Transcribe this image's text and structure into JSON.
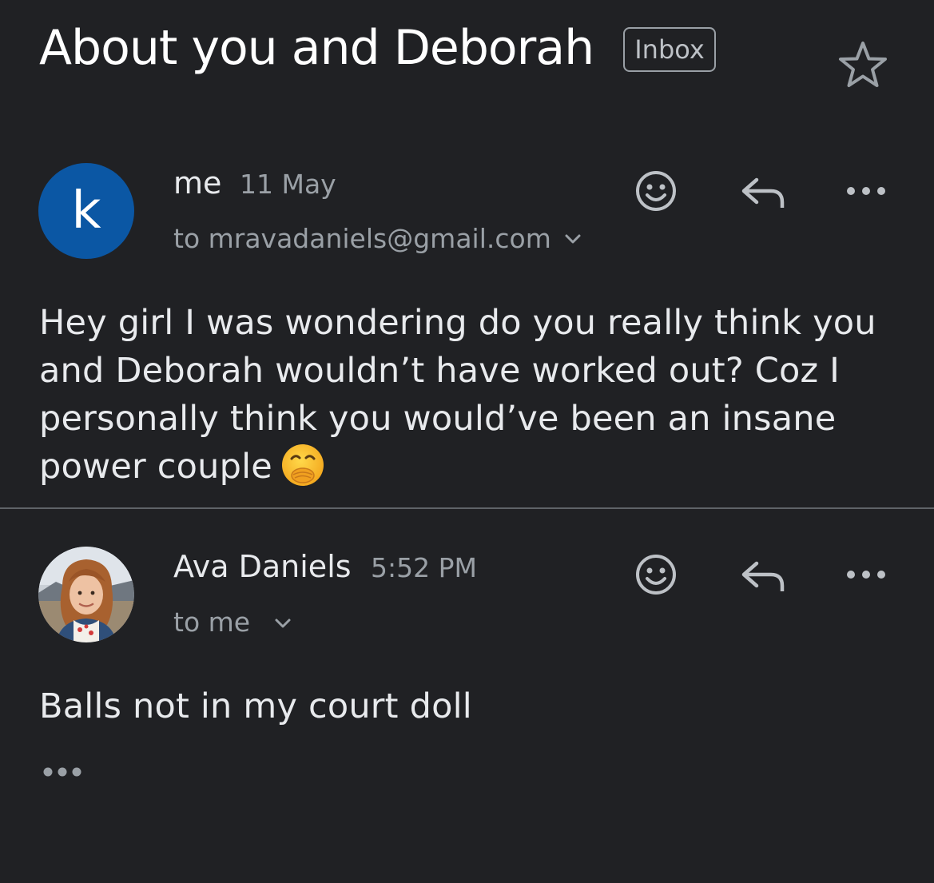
{
  "thread": {
    "subject": "About you and Deborah",
    "label": "Inbox",
    "star_icon": "star-outline-icon"
  },
  "messages": [
    {
      "avatar_letter": "k",
      "avatar_color": "#0b57a4",
      "sender": "me",
      "time": "11 May",
      "recipient": "to mravadaniels@gmail.com",
      "body": "Hey girl I was wondering do you really think you and Deborah wouldn’t have worked out? Coz I personally think you would’ve been an insane power couple",
      "emoji": "face-with-hand-over-mouth-emoji"
    },
    {
      "avatar": "profile-photo",
      "sender": "Ava Daniels",
      "time": "5:52 PM",
      "recipient": "to me",
      "body": "Balls not in my court doll"
    }
  ],
  "icons": {
    "react": "emoji-react-icon",
    "reply": "reply-icon",
    "more": "more-options-icon",
    "expand": "chevron-down-icon",
    "trimmed": "show-trimmed-content-icon"
  },
  "colors": {
    "background": "#202124",
    "text": "#e8eaed",
    "secondary": "#9aa0a6",
    "divider": "#5f6368"
  }
}
